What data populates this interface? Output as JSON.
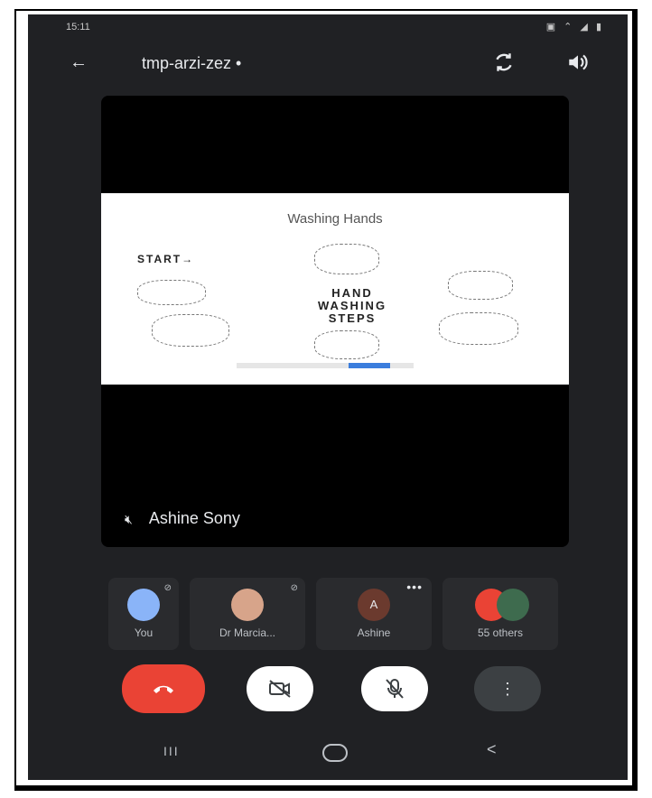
{
  "status_bar": {
    "time": "15:11",
    "icons": "▣ ⌃ ◢ ▮"
  },
  "top_bar": {
    "back_icon": "arrow-left",
    "meeting_code": "tmp-arzi-zez",
    "recording_dot": "•",
    "switch_camera_icon": "switch-camera",
    "speaker_icon": "speaker"
  },
  "presentation": {
    "slide_title": "Washing Hands",
    "slide_start": "START→",
    "slide_center_text": "HAND\nWASHING\nSTEPS",
    "presenter_name": "Ashine Sony",
    "presenter_mic_icon": "mic-off"
  },
  "participants": [
    {
      "label": "You",
      "avatar_color": "#8ab4f8",
      "muted": true
    },
    {
      "label": "Dr Marcia...",
      "avatar_color": "#d7a48a",
      "muted": true
    },
    {
      "label": "Ashine",
      "avatar_color": "#6b3a2e",
      "initial": "A",
      "more": "•••"
    },
    {
      "label": "55 others",
      "avatar_color": "#ea4335"
    }
  ],
  "controls": {
    "end_call_icon": "phone-hangup",
    "camera_icon": "camera-off",
    "mic_icon": "mic-off",
    "more_icon": "more-vert",
    "end_call_color": "#ea4335"
  },
  "nav": {
    "recent": "III",
    "back": "<"
  }
}
